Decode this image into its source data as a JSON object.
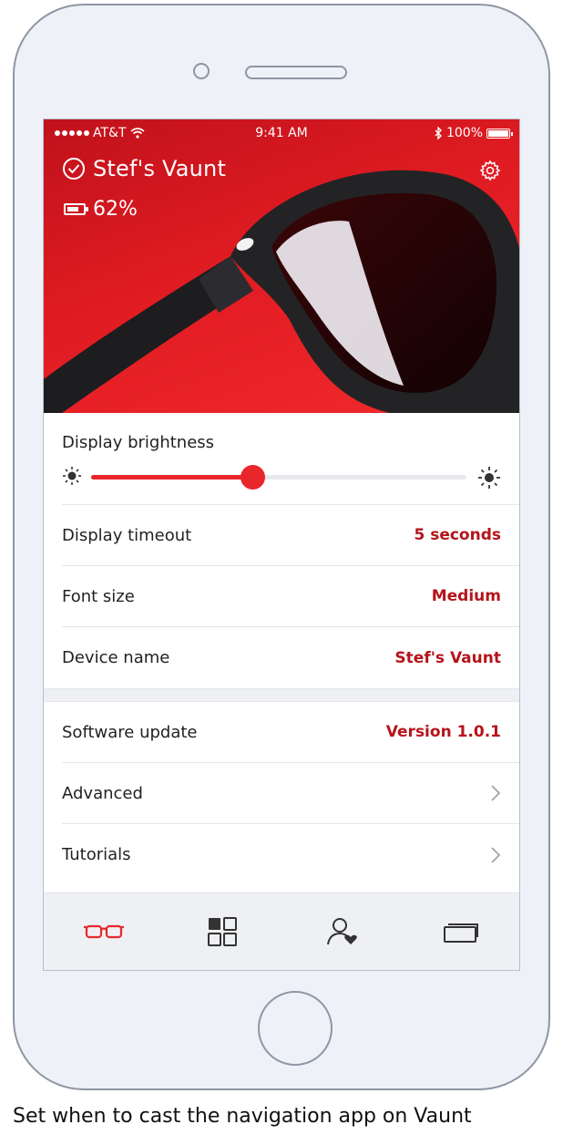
{
  "status_bar": {
    "carrier": "AT&T",
    "time": "9:41 AM",
    "battery": "100%"
  },
  "device": {
    "name": "Stef's Vaunt",
    "battery_level": "62%"
  },
  "settings": {
    "brightness_label": "Display brightness",
    "brightness_fraction": 0.43,
    "rows": [
      {
        "label": "Display timeout",
        "value": "5 seconds"
      },
      {
        "label": "Font size",
        "value": "Medium"
      },
      {
        "label": "Device name",
        "value": "Stef's Vaunt"
      }
    ],
    "rows2": [
      {
        "label": "Software update",
        "value": "Version 1.0.1"
      },
      {
        "label": "Advanced",
        "value": ""
      },
      {
        "label": "Tutorials",
        "value": ""
      }
    ]
  },
  "tabs": [
    {
      "icon": "glasses-icon",
      "active": true
    },
    {
      "icon": "grid-icon",
      "active": false
    },
    {
      "icon": "contact-heart-icon",
      "active": false
    },
    {
      "icon": "cards-icon",
      "active": false
    }
  ],
  "colors": {
    "accent": "#e9262b",
    "value_text": "#b5141b",
    "hero_red": "#e01b22"
  },
  "caption": "Set when to cast the navigation app on Vaunt"
}
